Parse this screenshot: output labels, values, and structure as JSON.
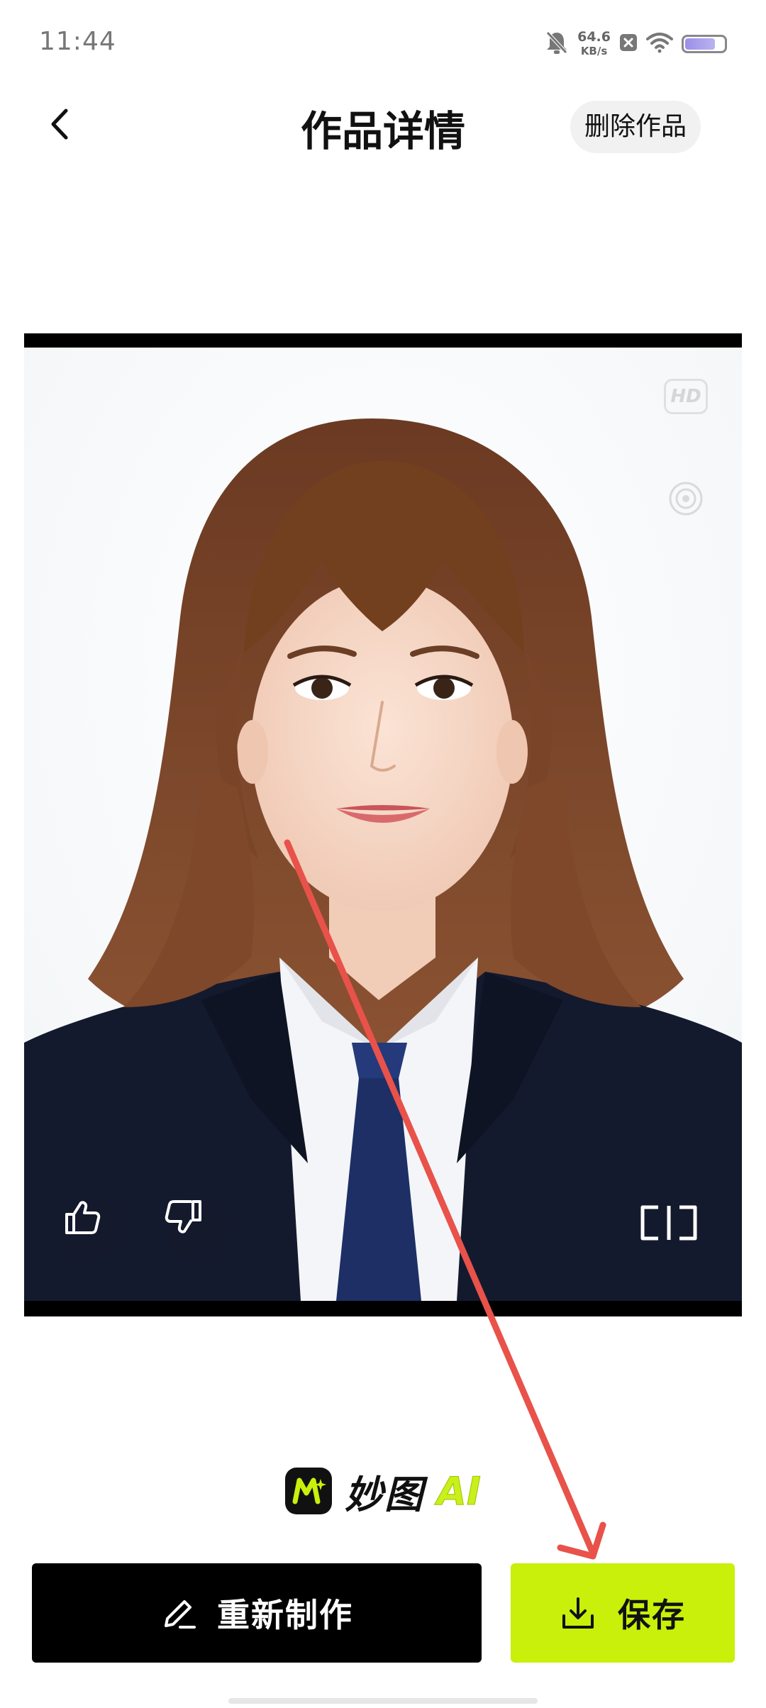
{
  "status_bar": {
    "time": "11:44",
    "net_speed_value": "64.6",
    "net_speed_unit": "KB/s",
    "icons": [
      "mute-bell-icon",
      "close-box-icon",
      "wifi-icon",
      "battery-icon"
    ],
    "battery_level": 0.8
  },
  "header": {
    "back_icon": "chevron-left-icon",
    "title": "作品详情",
    "delete_label": "删除作品"
  },
  "photo": {
    "hd_label": "HD",
    "subject": "ID photo portrait",
    "overlay_icons": [
      "hd-icon",
      "target-icon"
    ],
    "action_icons": [
      "thumbs-up-icon",
      "thumbs-down-icon",
      "compare-icon"
    ]
  },
  "brand": {
    "name": "妙图",
    "suffix": "AI",
    "logo_icon": "brand-m-logo-icon"
  },
  "actions": {
    "remake_label": "重新制作",
    "remake_icon": "pencil-icon",
    "save_label": "保存",
    "save_icon": "download-icon"
  },
  "colors": {
    "accent": "#c8f00a",
    "primary_button": "#000000",
    "annotation_arrow": "#e8524a",
    "suit": "#141a2e",
    "tie": "#1e2f66",
    "hair": "#7a4428"
  }
}
